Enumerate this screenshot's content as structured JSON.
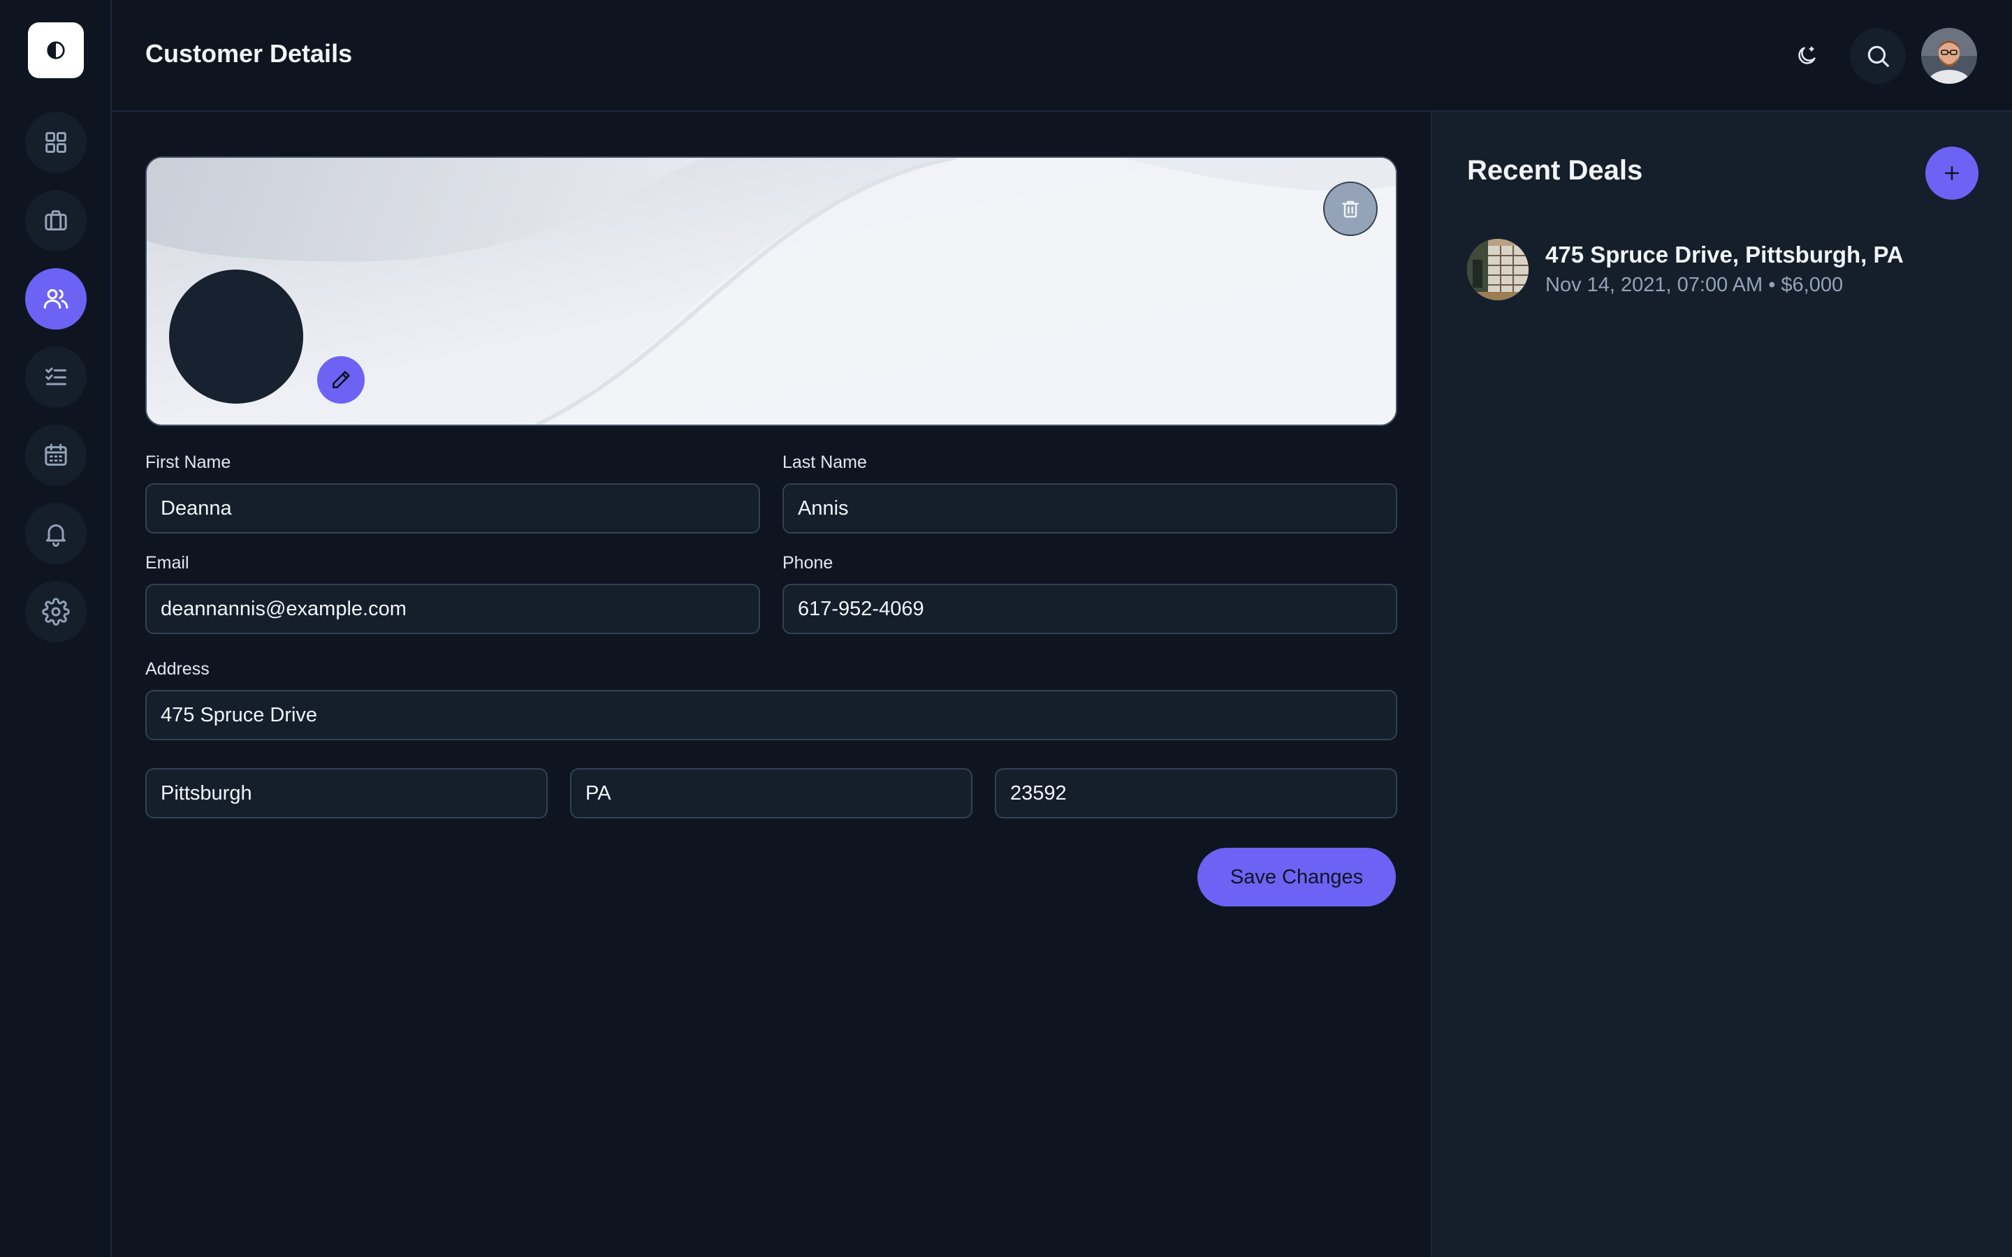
{
  "header": {
    "title": "Customer Details",
    "icons": {
      "theme": "moon-icon",
      "search": "search-icon",
      "avatar": "user-avatar"
    }
  },
  "sidebar": {
    "logo_icon": "contrast-icon",
    "items": [
      {
        "id": "dashboard",
        "icon": "grid-icon",
        "active": false
      },
      {
        "id": "deals",
        "icon": "briefcase-icon",
        "active": false
      },
      {
        "id": "customers",
        "icon": "users-icon",
        "active": true
      },
      {
        "id": "tasks",
        "icon": "checklist-icon",
        "active": false
      },
      {
        "id": "calendar",
        "icon": "calendar-icon",
        "active": false
      },
      {
        "id": "notifications",
        "icon": "bell-icon",
        "active": false
      },
      {
        "id": "settings",
        "icon": "gear-icon",
        "active": false
      }
    ]
  },
  "form": {
    "first_name": {
      "label": "First Name",
      "value": "Deanna"
    },
    "last_name": {
      "label": "Last Name",
      "value": "Annis"
    },
    "email": {
      "label": "Email",
      "value": "deannannis@example.com"
    },
    "phone": {
      "label": "Phone",
      "value": "617-952-4069"
    },
    "address": {
      "label": "Address",
      "value": "475 Spruce Drive"
    },
    "city": {
      "value": "Pittsburgh"
    },
    "state": {
      "value": "PA"
    },
    "zip": {
      "value": "23592"
    },
    "save_label": "Save Changes"
  },
  "recent_deals": {
    "title": "Recent Deals",
    "items": [
      {
        "title": "475 Spruce Drive, Pittsburgh, PA",
        "meta": "Nov 14, 2021, 07:00 AM • $6,000"
      }
    ]
  },
  "colors": {
    "accent": "#6c63f5",
    "background": "#0e1520",
    "panel": "#151e2b",
    "border": "#334155"
  }
}
